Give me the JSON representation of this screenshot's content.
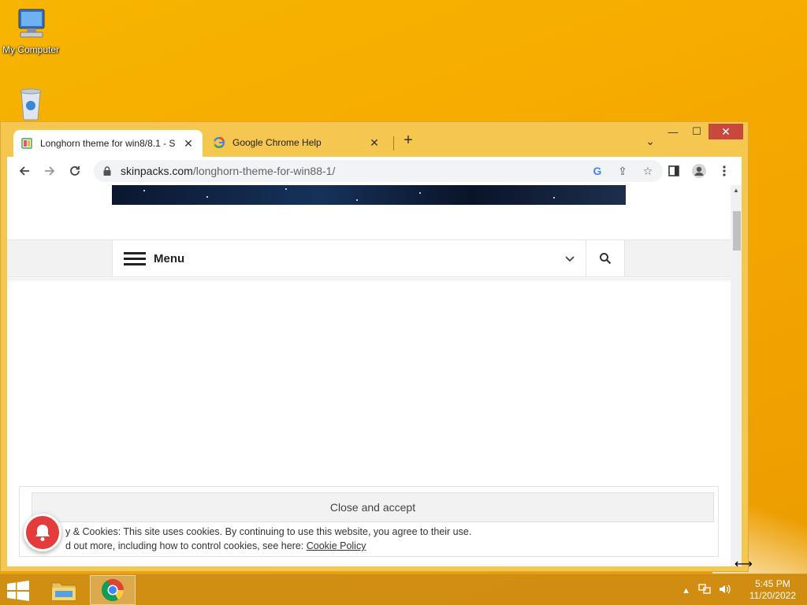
{
  "desktop": {
    "icons": [
      {
        "label": "My Computer",
        "icon": "computer-icon"
      },
      {
        "label": "",
        "icon": "recycle-bin-icon"
      }
    ]
  },
  "browser": {
    "tabs": [
      {
        "title": "Longhorn theme for win8/8.1 - S",
        "favicon": "skinpacks-favicon",
        "active": true
      },
      {
        "title": "Google Chrome Help",
        "favicon": "google-favicon",
        "active": false
      }
    ],
    "new_tab": "+",
    "url_domain": "skinpacks.com",
    "url_path": "/longhorn-theme-for-win88-1/",
    "controls": {
      "minimize": "—",
      "maximize": "☐",
      "close": "✕"
    }
  },
  "page": {
    "menu_label": "Menu",
    "cookie": {
      "accept_label": "Close and accept",
      "line1": "y & Cookies: This site uses cookies. By continuing to use this website, you agree to their use.",
      "line2_prefix": "d out more, including how to control cookies, see here: ",
      "policy_link": "Cookie Policy"
    }
  },
  "taskbar": {
    "items": [
      "start-button",
      "file-explorer",
      "google-chrome"
    ],
    "clock_time": "5:45 PM",
    "clock_date": "11/20/2022"
  },
  "colors": {
    "desktop_bg": "#f5a800",
    "window_frame": "#f6c74f",
    "close_button": "#c9483e",
    "notification_red": "#e43b3b"
  }
}
